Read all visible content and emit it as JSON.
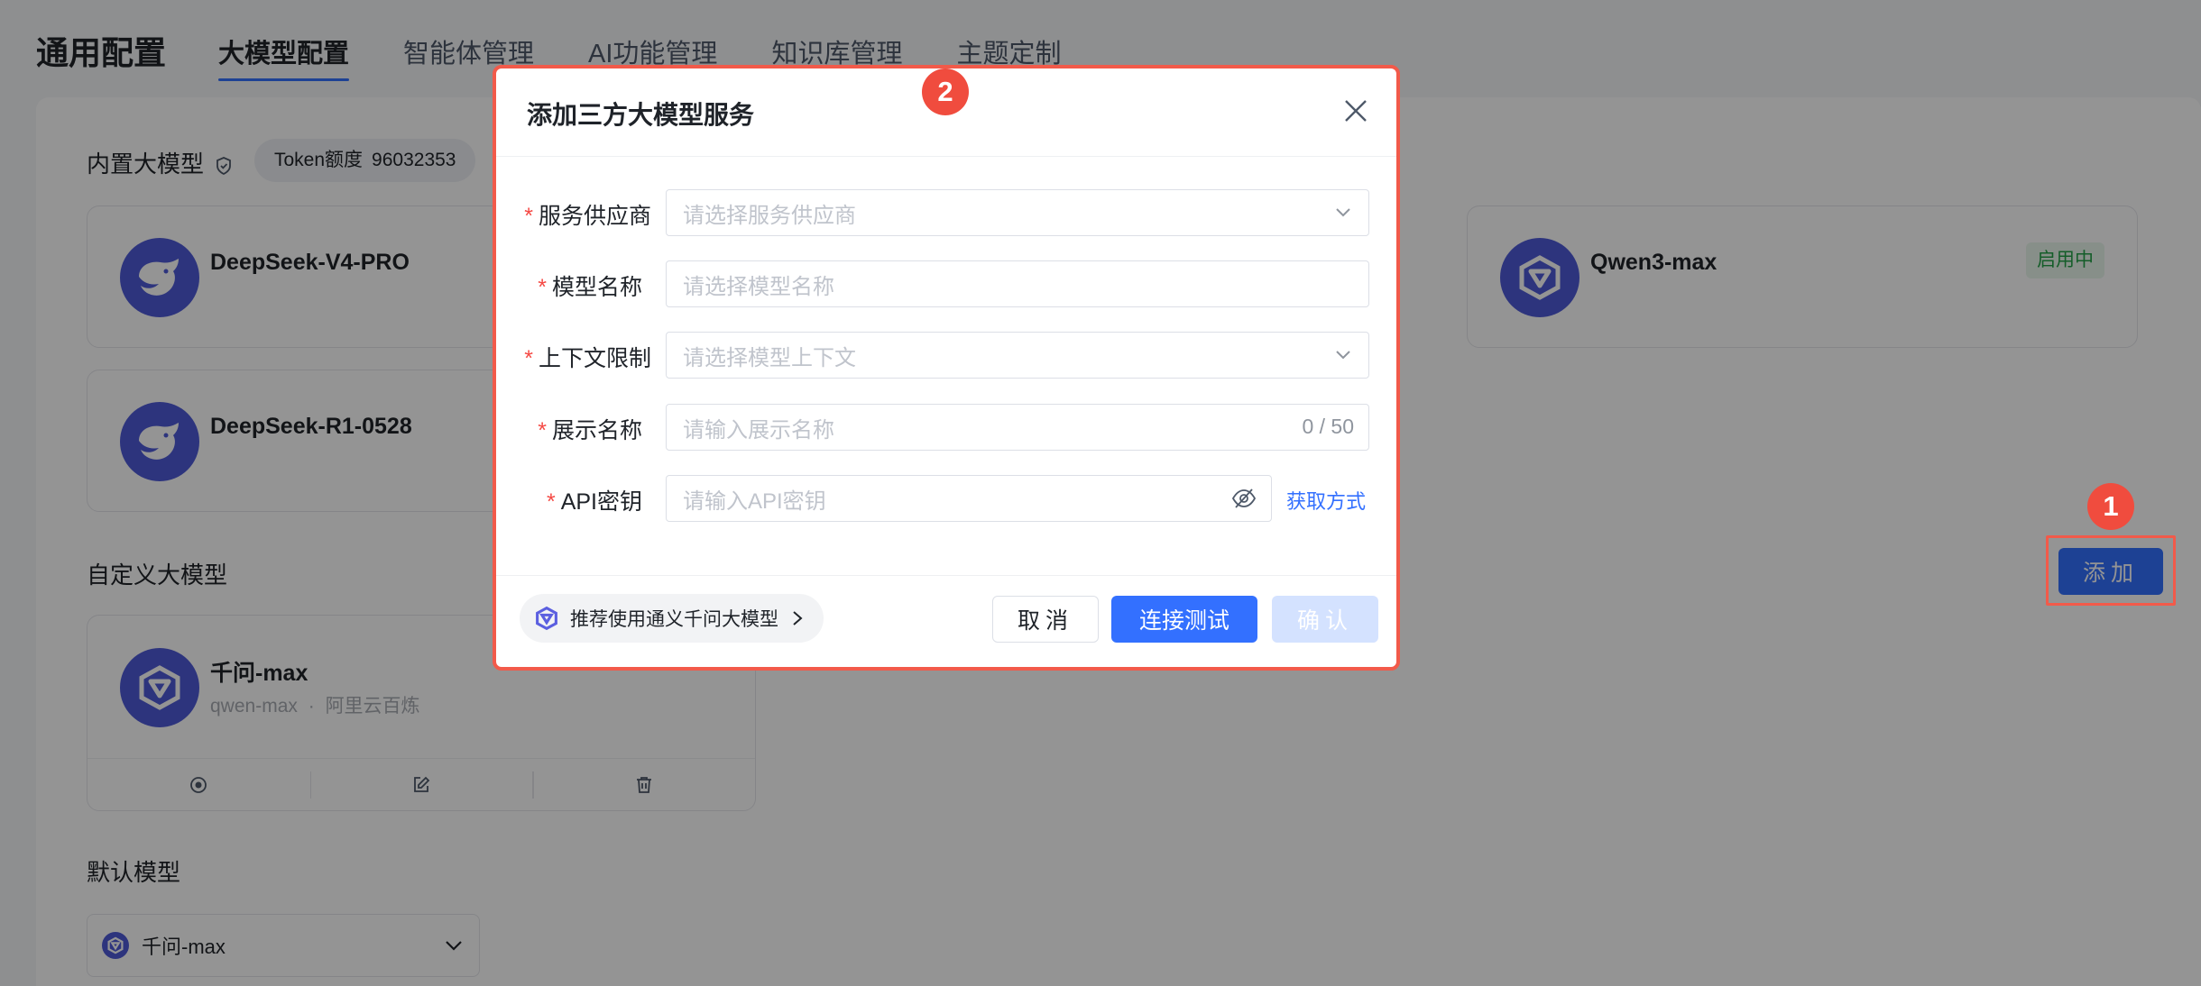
{
  "header": {
    "title": "通用配置",
    "tabs": [
      {
        "label": "大模型配置",
        "active": true
      },
      {
        "label": "智能体管理"
      },
      {
        "label": "AI功能管理"
      },
      {
        "label": "知识库管理"
      },
      {
        "label": "主题定制"
      }
    ]
  },
  "builtin": {
    "title": "内置大模型",
    "token_label": "Token额度",
    "token_value": "96032353",
    "models": [
      {
        "name": "DeepSeek-V4-PRO",
        "icon": "deepseek-icon"
      },
      {
        "name": "Qwen3-max",
        "status": "启用中",
        "icon": "qwen-icon"
      },
      {
        "name": "DeepSeek-R1-0528",
        "icon": "deepseek-icon"
      }
    ]
  },
  "custom": {
    "title": "自定义大模型",
    "add_label": "添加",
    "models": [
      {
        "name": "千问-max",
        "model_id": "qwen-max",
        "provider": "阿里云百炼",
        "icon": "qwen-icon"
      }
    ]
  },
  "default_model": {
    "title": "默认模型",
    "value": "千问-max"
  },
  "dialog": {
    "title": "添加三方大模型服务",
    "fields": {
      "provider": {
        "label": "服务供应商",
        "placeholder": "请选择服务供应商"
      },
      "model_name": {
        "label": "模型名称",
        "placeholder": "请选择模型名称"
      },
      "context": {
        "label": "上下文限制",
        "placeholder": "请选择模型上下文"
      },
      "display_name": {
        "label": "展示名称",
        "placeholder": "请输入展示名称",
        "counter": "0 / 50"
      },
      "api_key": {
        "label": "API密钥",
        "placeholder": "请输入API密钥",
        "link": "获取方式"
      }
    },
    "recommend": "推荐使用通义千问大模型",
    "buttons": {
      "cancel": "取消",
      "test": "连接测试",
      "confirm": "确认"
    }
  },
  "annotations": {
    "step1": "1",
    "step2": "2"
  },
  "colors": {
    "primary": "#3370ff",
    "annotation": "#f25a4a",
    "success": "#24a148",
    "model_logo": "#4e5bd8"
  }
}
